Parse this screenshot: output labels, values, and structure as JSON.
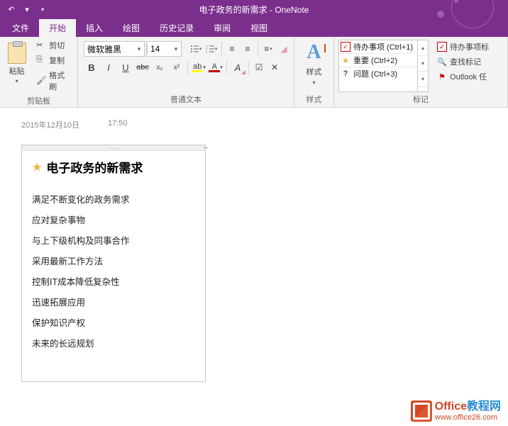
{
  "window": {
    "title": "电子政务的新需求 - OneNote"
  },
  "tabs": {
    "file": "文件",
    "home": "开始",
    "insert": "插入",
    "draw": "绘图",
    "history": "历史记录",
    "review": "审阅",
    "view": "视图"
  },
  "clipboard": {
    "paste": "粘贴",
    "cut": "剪切",
    "copy": "复制",
    "format_painter": "格式刷",
    "group": "剪贴板"
  },
  "text": {
    "font_name": "微软雅黑",
    "font_size": "14",
    "bold": "B",
    "italic": "I",
    "underline": "U",
    "strike": "abc",
    "sub": "x₂",
    "sup": "x²",
    "highlight": "A",
    "font_color": "A",
    "clear": "A",
    "group": "普通文本"
  },
  "styles": {
    "label": "样式",
    "group": "样式"
  },
  "tags": {
    "items": [
      {
        "label": "待办事项 (Ctrl+1)"
      },
      {
        "label": "重要 (Ctrl+2)"
      },
      {
        "label": "问题 (Ctrl+3)"
      }
    ],
    "todo_tag": "待办事项标",
    "find_tags": "查找标记",
    "outlook": "Outlook 任",
    "group": "标记"
  },
  "page": {
    "date": "2015年12月10日",
    "time": "17:50",
    "title": "电子政务的新需求",
    "lines": [
      "满足不断变化的政务需求",
      "应对复杂事物",
      "与上下级机构及同事合作",
      "采用最新工作方法",
      "控制IT成本降低复杂性",
      "迅速拓展应用",
      "保护知识产权",
      "未来的长远规划"
    ]
  },
  "watermark": {
    "brand1": "Office",
    "brand2": "教程网",
    "url": "www.office26.com"
  },
  "colors": {
    "brand": "#7b2f8c",
    "accent_orange": "#d24726",
    "accent_blue": "#2a8dd4",
    "font_color": "#c00000",
    "highlight": "#ffff00"
  }
}
